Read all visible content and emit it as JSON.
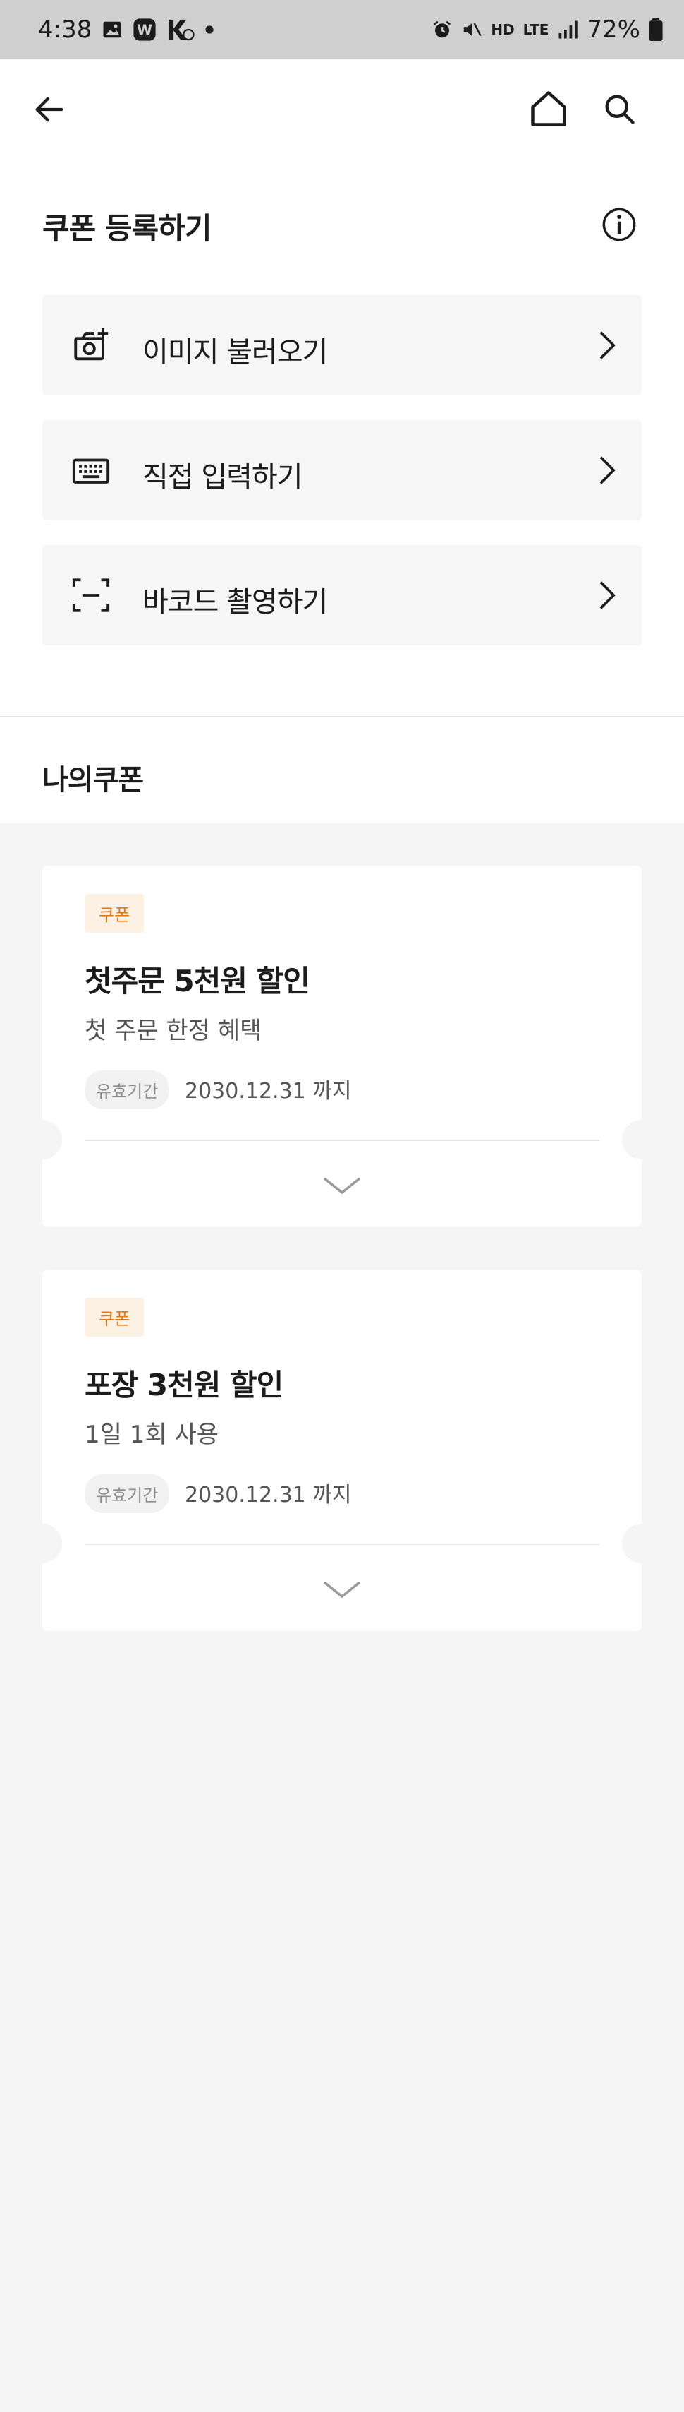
{
  "status_bar": {
    "time": "4:38",
    "battery": "72%",
    "network": "LTE",
    "hd": "HD"
  },
  "nav": {
    "back_icon": "arrow-left-icon",
    "home_icon": "home-icon",
    "search_icon": "search-icon"
  },
  "register": {
    "title": "쿠폰 등록하기",
    "info_icon": "info-icon",
    "options": [
      {
        "label": "이미지 불러오기",
        "icon": "camera-plus-icon"
      },
      {
        "label": "직접 입력하기",
        "icon": "keyboard-icon"
      },
      {
        "label": "바코드 촬영하기",
        "icon": "scan-frame-icon"
      }
    ]
  },
  "my_coupons": {
    "title": "나의쿠폰",
    "items": [
      {
        "badge": "쿠폰",
        "title": "첫주문 5천원 할인",
        "subtitle": "첫 주문 한정 혜택",
        "period_label": "유효기간",
        "period_value": "2030.12.31 까지"
      },
      {
        "badge": "쿠폰",
        "title": "포장 3천원 할인",
        "subtitle": "1일 1회 사용",
        "period_label": "유효기간",
        "period_value": "2030.12.31 까지"
      }
    ]
  },
  "colors": {
    "badge_bg": "#fdf1e4",
    "badge_text": "#e07a1a",
    "page_bg": "#f5f5f5"
  }
}
